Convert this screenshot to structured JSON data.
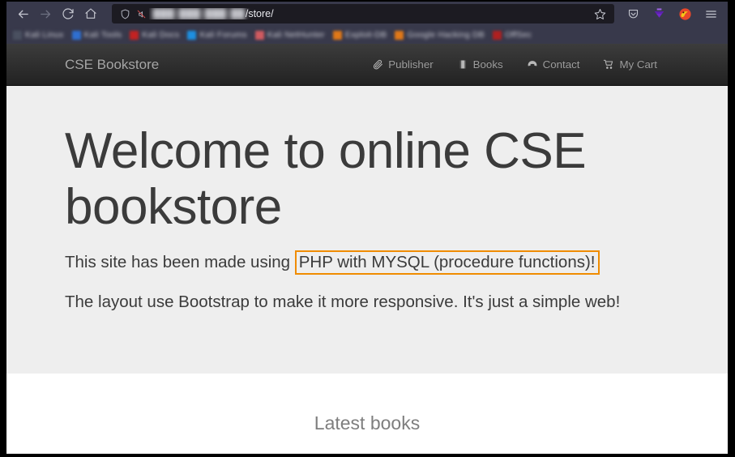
{
  "browser": {
    "toolbar": {
      "back_icon": "back-arrow-icon",
      "forward_icon": "forward-arrow-icon",
      "reload_icon": "reload-icon",
      "home_icon": "home-icon",
      "shield_icon": "shield-icon",
      "permissions_icon": "blocked-autoplay-icon",
      "bookmark_star_icon": "star-icon",
      "pocket_icon": "pocket-icon",
      "downloads_icon": "downloads-icon",
      "extension_icon": "extension-icon",
      "menu_icon": "hamburger-menu-icon"
    },
    "url": {
      "host_redacted": "███ ███ ███ ██",
      "path": "/store/"
    },
    "bookmarks": [
      {
        "label": "Kali Linux",
        "color": "#4a5060"
      },
      {
        "label": "Kali Tools",
        "color": "#2f6fd0"
      },
      {
        "label": "Kali Docs",
        "color": "#c42222"
      },
      {
        "label": "Kali Forums",
        "color": "#1e8fe0"
      },
      {
        "label": "Kali NetHunter",
        "color": "#d05a60"
      },
      {
        "label": "Exploit-DB",
        "color": "#e07818"
      },
      {
        "label": "Google Hacking DB",
        "color": "#e07818"
      },
      {
        "label": "OffSec",
        "color": "#b02020"
      }
    ]
  },
  "site": {
    "brand": "CSE Bookstore",
    "nav": [
      {
        "label": "Publisher",
        "icon": "paperclip-icon"
      },
      {
        "label": "Books",
        "icon": "book-icon"
      },
      {
        "label": "Contact",
        "icon": "phone-icon"
      },
      {
        "label": "My Cart",
        "icon": "shopping-cart-icon"
      }
    ],
    "hero": {
      "title": "Welcome to online CSE bookstore",
      "lead_prefix": "This site has been made using ",
      "lead_highlight": "PHP with MYSQL (procedure functions)!",
      "lead_second": "The layout use Bootstrap to make it more responsive. It's just a simple web!"
    },
    "latest_books_title": "Latest books",
    "colors": {
      "navbar_dark": "#222222",
      "jumbotron_bg": "#eeeeee",
      "highlight_border": "#f08c00",
      "text": "#3b3b3b",
      "muted": "#7e7e7e"
    }
  }
}
